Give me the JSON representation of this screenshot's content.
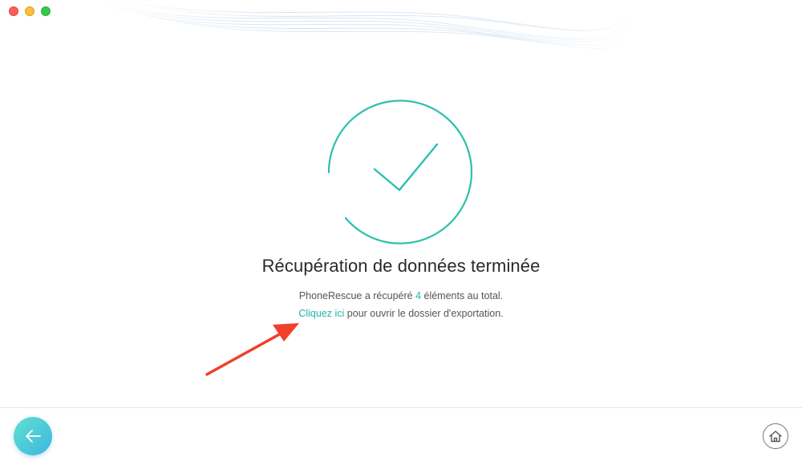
{
  "window": {
    "controls": [
      "close",
      "minimize",
      "maximize"
    ]
  },
  "result": {
    "heading": "Récupération de données terminée",
    "summary_prefix": "PhoneRescue a récupéré ",
    "count": "4",
    "summary_suffix": " éléments au total.",
    "link_text": "Cliquez ici",
    "link_suffix": " pour ouvrir le dossier d'exportation."
  },
  "footer": {
    "back_icon": "arrow-left-icon",
    "home_icon": "home-icon"
  },
  "colors": {
    "accent": "#1fb5a6",
    "arrow": "#f0402a",
    "back_gradient_start": "#5fe0cf",
    "back_gradient_end": "#3db7e0"
  }
}
